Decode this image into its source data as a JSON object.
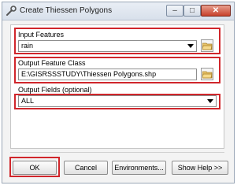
{
  "window": {
    "title": "Create Thiessen Polygons",
    "min_label": "–",
    "max_label": "□",
    "close_label": "✕"
  },
  "form": {
    "input_features": {
      "label": "Input Features",
      "value": "rain"
    },
    "output_feature_class": {
      "label": "Output Feature Class",
      "value": "E:\\GISRSSSTUDY\\Thiessen Polygons.shp"
    },
    "output_fields": {
      "label": "Output Fields (optional)",
      "value": "ALL"
    }
  },
  "buttons": {
    "ok": "OK",
    "cancel": "Cancel",
    "environments": "Environments...",
    "show_help": "Show Help >>"
  },
  "colors": {
    "highlight": "#d0262b",
    "close_button": "#c7402b"
  },
  "icons": {
    "title": "wrench-icon",
    "browse": "folder-icon",
    "dropdown": "chevron-down-icon"
  }
}
